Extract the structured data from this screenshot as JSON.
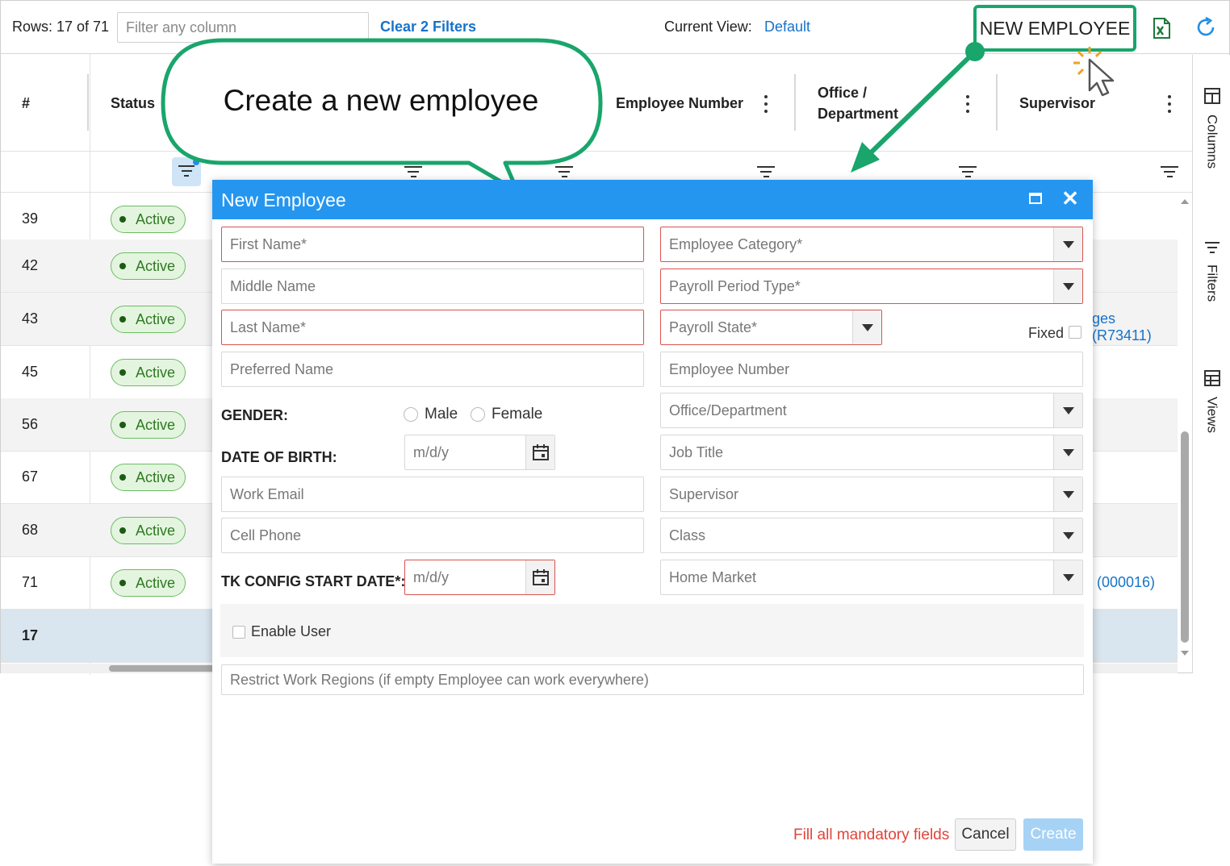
{
  "toolbar": {
    "rows_label": "Rows: 17 of 71",
    "filter_placeholder": "Filter any column",
    "clear_filters": "Clear 2 Filters",
    "current_view_label": "Current View:",
    "current_view_value": "Default",
    "new_employee_button": "NEW EMPLOYEE"
  },
  "grid": {
    "headers": {
      "num": "#",
      "status": "Status",
      "employee_number": "Employee Number",
      "office_department": "Office / Department",
      "supervisor": "Supervisor"
    },
    "rows": [
      {
        "num": "39",
        "status": "Active"
      },
      {
        "num": "42",
        "status": "Active"
      },
      {
        "num": "43",
        "status": "Active",
        "supervisor": "ges (R73411)"
      },
      {
        "num": "45",
        "status": "Active"
      },
      {
        "num": "56",
        "status": "Active"
      },
      {
        "num": "67",
        "status": "Active"
      },
      {
        "num": "68",
        "status": "Active"
      },
      {
        "num": "71",
        "status": "Active",
        "supervisor": "(000016)"
      }
    ],
    "total_row": "17"
  },
  "sidebar": {
    "columns": "Columns",
    "filters": "Filters",
    "views": "Views"
  },
  "callout": {
    "text": "Create a new employee"
  },
  "modal": {
    "title": "New Employee",
    "left": {
      "first_name": "First Name*",
      "middle_name": "Middle Name",
      "last_name": "Last Name*",
      "preferred_name": "Preferred Name",
      "gender_label": "GENDER:",
      "gender_male": "Male",
      "gender_female": "Female",
      "dob_label": "DATE OF BIRTH:",
      "dob_placeholder": "m/d/y",
      "work_email": "Work Email",
      "cell_phone": "Cell Phone",
      "tk_label": "TK CONFIG START DATE*:",
      "tk_placeholder": "m/d/y"
    },
    "right": {
      "employee_category": "Employee Category*",
      "payroll_period_type": "Payroll Period Type*",
      "payroll_state": "Payroll State*",
      "fixed_label": "Fixed",
      "employee_number": "Employee Number",
      "office_department": "Office/Department",
      "job_title": "Job Title",
      "supervisor": "Supervisor",
      "class": "Class",
      "home_market": "Home Market"
    },
    "enable_user": "Enable User",
    "restrict_regions": "Restrict Work Regions (if empty Employee can work everywhere)",
    "fill_message": "Fill all mandatory fields",
    "cancel": "Cancel",
    "create": "Create"
  },
  "colors": {
    "accent_blue": "#2496f0",
    "link_blue": "#1673c9",
    "highlight_green": "#19a56b",
    "required_red": "#d9534f",
    "status_green": "#e4f5df"
  }
}
